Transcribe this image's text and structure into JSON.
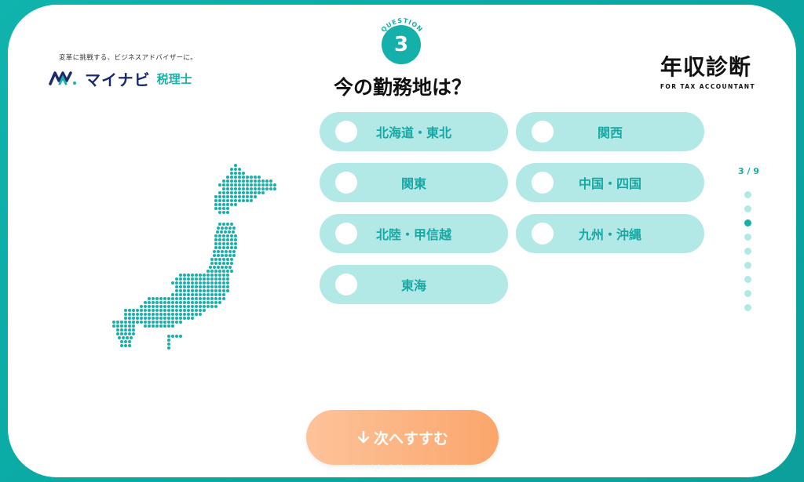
{
  "header": {
    "tagline": "変革に挑戦する、ビジネスアドバイザーに。",
    "logo_name": "マイナビ",
    "logo_sub": "税理士",
    "brand_title": "年収診断",
    "brand_sub": "FOR TAX ACCOUNTANT"
  },
  "question": {
    "badge_text": "QUESTION",
    "number": "3",
    "title": "今の勤務地は？"
  },
  "options": [
    {
      "label": "北海道・東北"
    },
    {
      "label": "関西"
    },
    {
      "label": "関東"
    },
    {
      "label": "中国・四国"
    },
    {
      "label": "北陸・甲信越"
    },
    {
      "label": "九州・沖縄"
    },
    {
      "label": "東海"
    }
  ],
  "progress": {
    "label": "3 / 9",
    "current": 3,
    "total": 9
  },
  "next_button": {
    "label": "次へすすむ"
  },
  "footer": {
    "copyright": "Copyright © Mynavi Corporation"
  },
  "colors": {
    "accent": "#16b0aa",
    "option_bg": "#b2e8e6",
    "button_orange": "#fba66b",
    "background_teal": "#0aa9a4"
  },
  "icons": {
    "logo": "mynavi-logo-icon",
    "arrow": "arrow-down-icon",
    "map": "japan-map-icon"
  }
}
